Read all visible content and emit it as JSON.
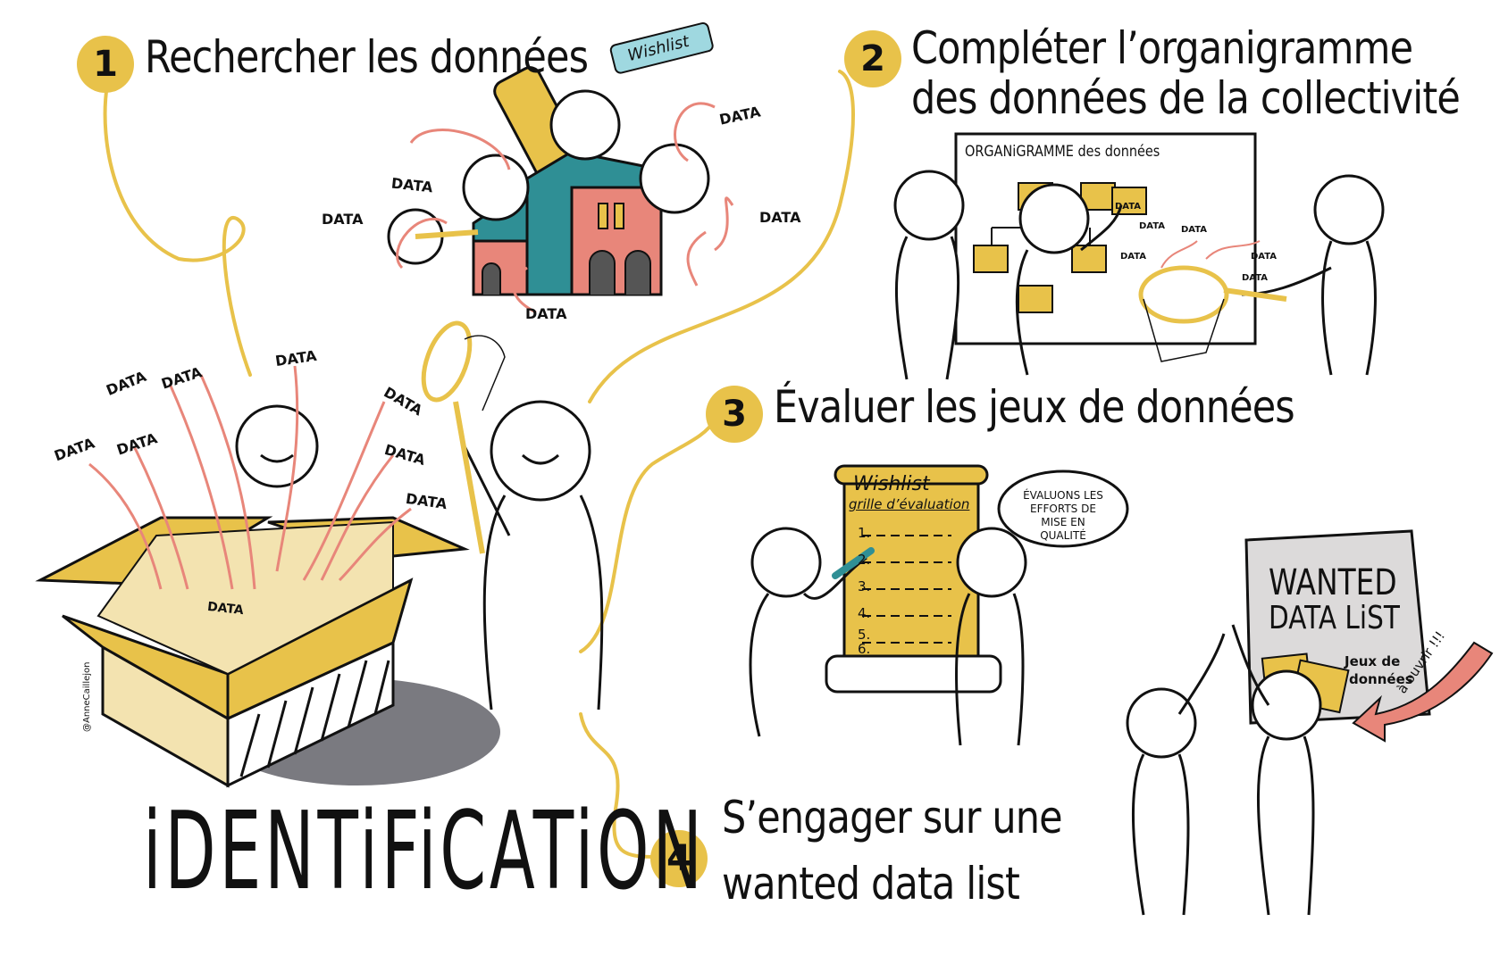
{
  "steps": [
    {
      "number": "1",
      "title": "Rechercher les données"
    },
    {
      "number": "2",
      "title_line1": "Compléter l’organigramme",
      "title_line2": "des données de la collectivité"
    },
    {
      "number": "3",
      "title": "Évaluer les jeux de données"
    },
    {
      "number": "4",
      "title_line1": "S’engager sur une",
      "title_line2": "wanted data list"
    }
  ],
  "main_title": "iDENTiFiCATiON",
  "data_tag": "DATA",
  "wishlist_tag": "Wishlist",
  "organigramme_title": "ORGANiGRAMME des données",
  "scroll": {
    "title": "Wishlist",
    "subtitle": "grille d’évaluation",
    "items": [
      "1.",
      "2.",
      "3.",
      "4.",
      "5.",
      "6."
    ]
  },
  "speech_bubble": "ÉVALUONS LES EFFORTS DE MISE EN QUALITÉ",
  "poster": {
    "title_line1": "WANTED",
    "title_line2": "DATA LiST",
    "caption_line1": "Jeux de",
    "caption_line2": "données"
  },
  "arrow_label": "à ouvrir !!!",
  "signature": "@AnneCaillejon",
  "colors": {
    "accent_yellow": "#e8c24a",
    "salmon": "#e8867a",
    "teal": "#2f8f95",
    "shadow_grey": "#7a7a80"
  }
}
